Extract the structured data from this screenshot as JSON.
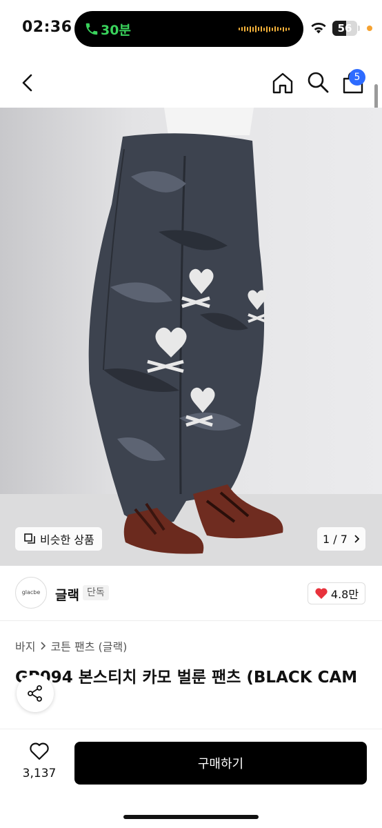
{
  "status_bar": {
    "time": "02:36",
    "call_duration": "30분",
    "battery_level": "56",
    "battery_fraction": 0.56,
    "accent_green": "#3ad35c",
    "accent_orange": "#f5a231"
  },
  "nav": {
    "back_icon": "chevron-left-icon",
    "home_icon": "home-icon",
    "search_icon": "search-icon",
    "cart_icon": "shopping-bag-icon",
    "cart_count": "5",
    "badge_color": "#2d6bff"
  },
  "gallery": {
    "similar_label": "비슷한 상품",
    "page_indicator": "1 / 7"
  },
  "brand": {
    "logo_text": "glacbe",
    "name": "글랙",
    "exclusive_tag": "단독",
    "likes": "4.8만",
    "heart_color": "#e8323c"
  },
  "breadcrumb": {
    "level1": "바지",
    "level2": "코튼 팬츠 (글랙)"
  },
  "product": {
    "title": "GP094 본스티치 카모 벌룬 팬츠 (BLACK CAM"
  },
  "bottom_bar": {
    "wish_count": "3,137",
    "buy_label": "구매하기"
  }
}
